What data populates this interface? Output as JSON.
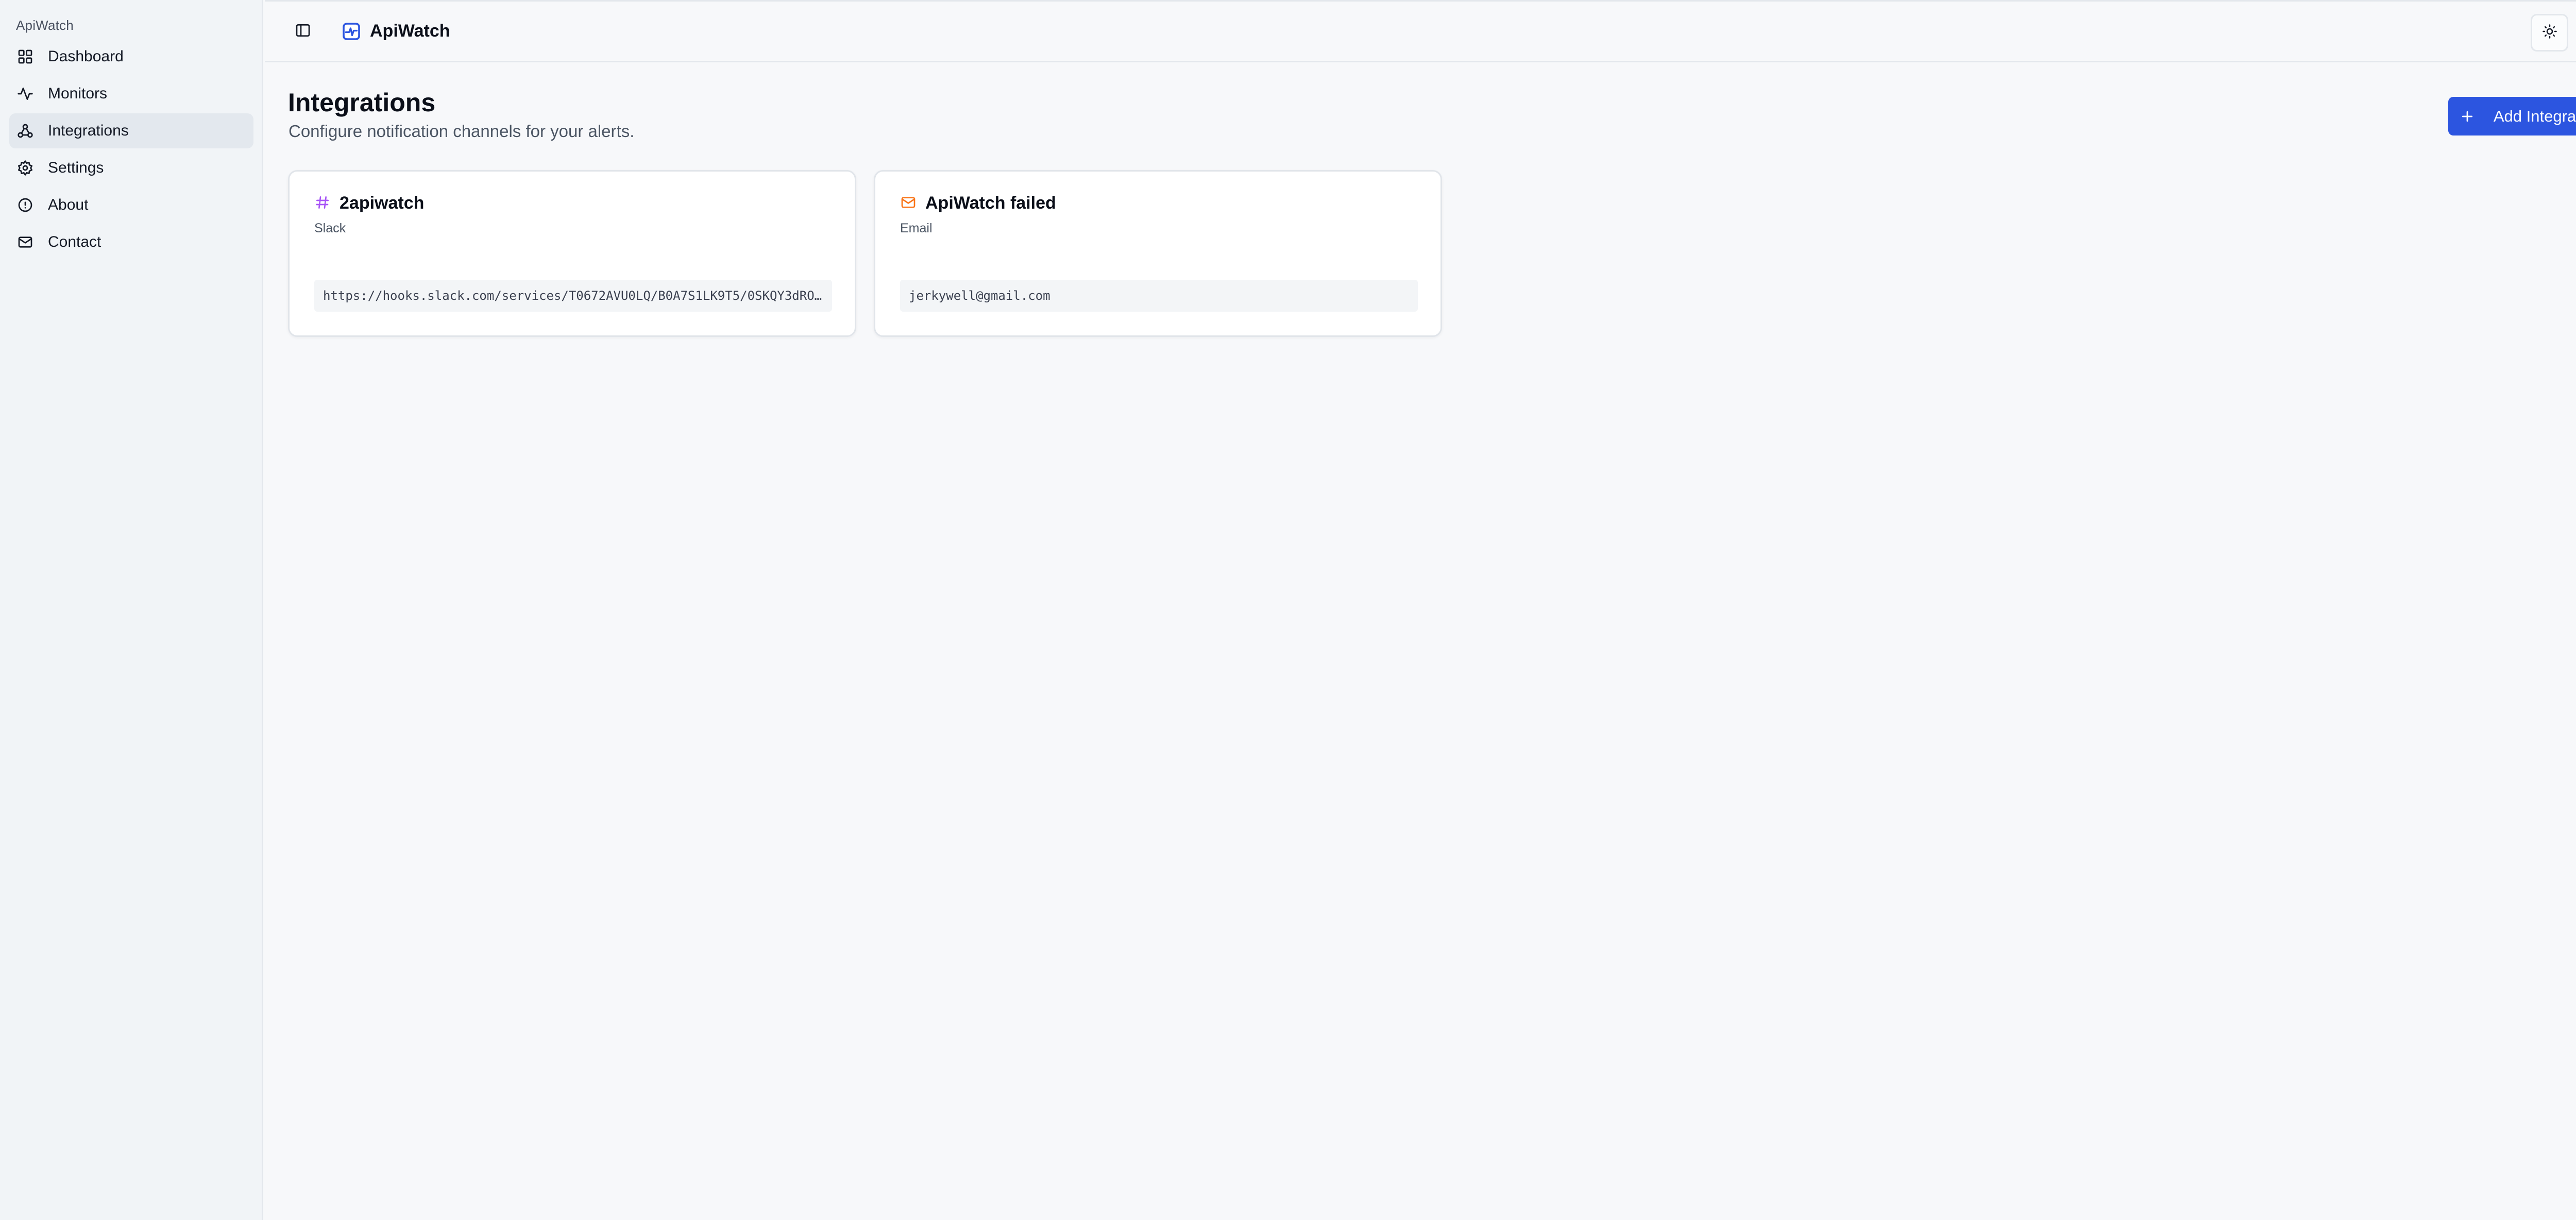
{
  "sidebar": {
    "app_label": "ApiWatch",
    "items": [
      {
        "label": "Dashboard",
        "icon": "grid-icon"
      },
      {
        "label": "Monitors",
        "icon": "activity-icon"
      },
      {
        "label": "Integrations",
        "icon": "integrations-icon",
        "active": true
      },
      {
        "label": "Settings",
        "icon": "gear-icon"
      },
      {
        "label": "About",
        "icon": "info-icon"
      },
      {
        "label": "Contact",
        "icon": "mail-icon"
      }
    ]
  },
  "header": {
    "title": "ApiWatch",
    "brand_icon": "pulse-logo-icon",
    "theme_icon": "sun-icon",
    "account_icon": "user-circle-icon"
  },
  "main": {
    "title": "Integrations",
    "subtitle": "Configure notification channels for your alerts.",
    "add_button_label": "Add Integration",
    "integrations": [
      {
        "name": "2apiwatch",
        "type": "Slack",
        "icon": "hash-icon",
        "icon_color": "#a855f7",
        "value": "https://hooks.slack.com/services/T0672AVU0LQ/B0A7S1LK9T5/0SKQY3dRO…"
      },
      {
        "name": "ApiWatch failed",
        "type": "Email",
        "icon": "mail-icon",
        "icon_color": "#f97316",
        "value": "jerkywell@gmail.com"
      }
    ]
  },
  "colors": {
    "accent": "#2c55e0",
    "sidebar_bg": "#f1f4f7",
    "active_item_bg": "#e3e8ee"
  }
}
